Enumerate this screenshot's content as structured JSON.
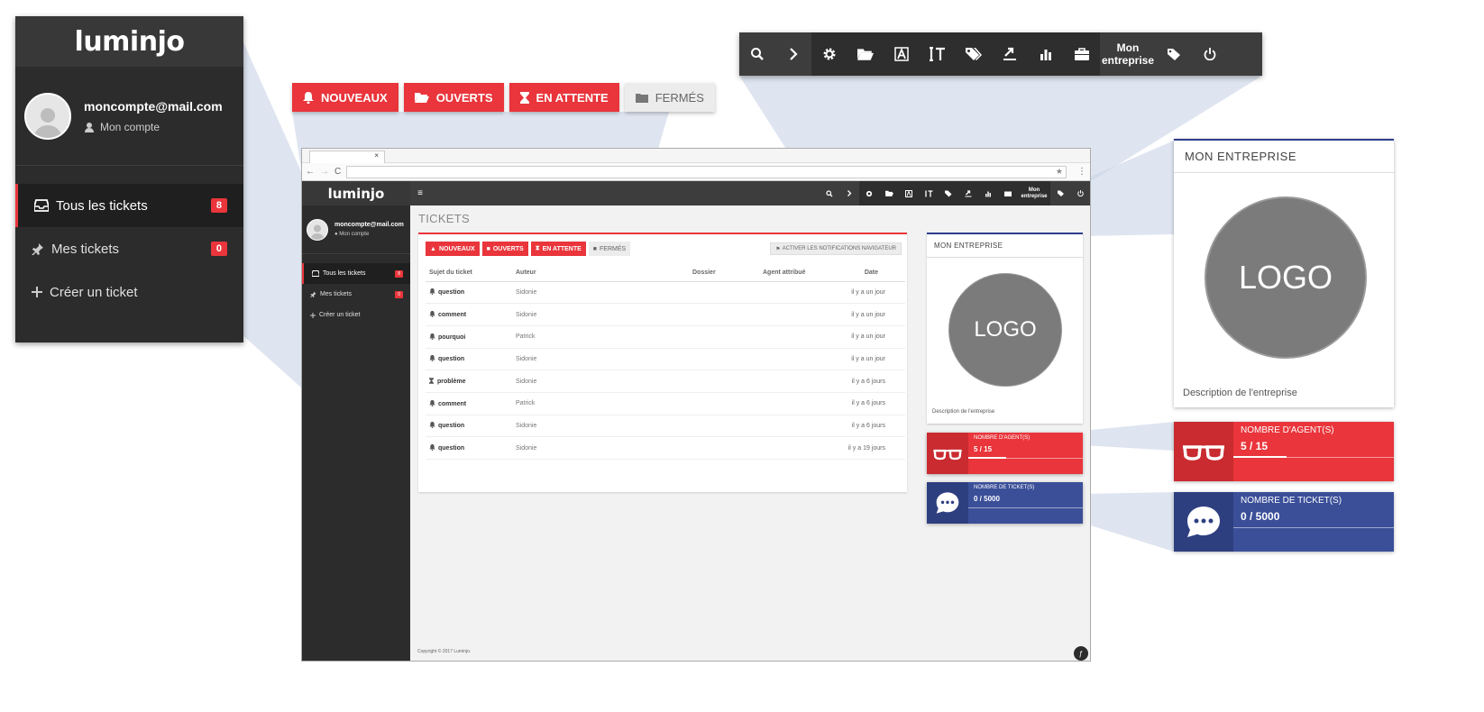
{
  "brand": {
    "logo_text": "luminjo"
  },
  "user": {
    "email": "moncompte@mail.com",
    "account_label": "Mon compte"
  },
  "sidebar": {
    "items": [
      {
        "label": "Tous les tickets",
        "badge": "8",
        "icon": "inbox-icon"
      },
      {
        "label": "Mes tickets",
        "badge": "0",
        "icon": "pin-icon"
      },
      {
        "label": "Créer un ticket",
        "icon": "plus-icon"
      }
    ]
  },
  "tabs": {
    "nouveaux": "NOUVEAUX",
    "ouverts": "OUVERTS",
    "en_attente": "EN ATTENTE",
    "fermes": "FERMÉS"
  },
  "toolbar": {
    "company_line1": "Mon",
    "company_line2": "entreprise",
    "icons": [
      "search-icon",
      "chevron-right-icon",
      "gear-icon",
      "folder-open-icon",
      "font-icon",
      "text-height-icon",
      "tags-icon",
      "upload-icon",
      "bar-chart-icon",
      "briefcase-icon",
      "tag-icon",
      "power-icon"
    ]
  },
  "page": {
    "title": "TICKETS",
    "notif_button": "ACTIVER LES NOTIFICATIONS NAVIGATEUR",
    "columns": {
      "subject": "Sujet du ticket",
      "author": "Auteur",
      "folder": "Dossier",
      "agent": "Agent attribué",
      "date": "Date"
    },
    "rows": [
      {
        "subject": "question",
        "author": "Sidonie",
        "date": "il y a un jour",
        "icon": "bell-icon"
      },
      {
        "subject": "comment",
        "author": "Sidonie",
        "date": "il y a un jour",
        "icon": "bell-icon"
      },
      {
        "subject": "pourquoi",
        "author": "Patrick",
        "date": "il y a un jour",
        "icon": "bell-icon"
      },
      {
        "subject": "question",
        "author": "Sidonie",
        "date": "il y a un jour",
        "icon": "bell-icon"
      },
      {
        "subject": "problème",
        "author": "Sidonie",
        "date": "il y a 6 jours",
        "icon": "hourglass-icon"
      },
      {
        "subject": "comment",
        "author": "Patrick",
        "date": "il y a 6 jours",
        "icon": "bell-icon"
      },
      {
        "subject": "question",
        "author": "Sidonie",
        "date": "il y a 6 jours",
        "icon": "bell-icon"
      },
      {
        "subject": "question",
        "author": "Sidonie",
        "date": "il y a 19 jours",
        "icon": "bell-icon"
      }
    ],
    "copyright": "Copyright © 2017 Luminjo."
  },
  "company": {
    "title": "MON ENTREPRISE",
    "logo_text": "LOGO",
    "description": "Description de l'entreprise",
    "agents": {
      "label": "NOMBRE D'AGENT(S)",
      "value": "5 / 15",
      "fraction": 0.333
    },
    "tickets": {
      "label": "NOMBRE DE TICKET(S)",
      "value": "0 / 5000",
      "fraction": 0
    }
  },
  "browser": {
    "tab_close": "×",
    "star": "★",
    "menu": "⋮",
    "back": "←",
    "forward": "→",
    "reload": "C"
  },
  "colors": {
    "accent_red": "#e9353b",
    "accent_blue": "#3b4f99",
    "sidebar_dark": "#2c2c2c",
    "topbar": "#3d3d3d"
  }
}
